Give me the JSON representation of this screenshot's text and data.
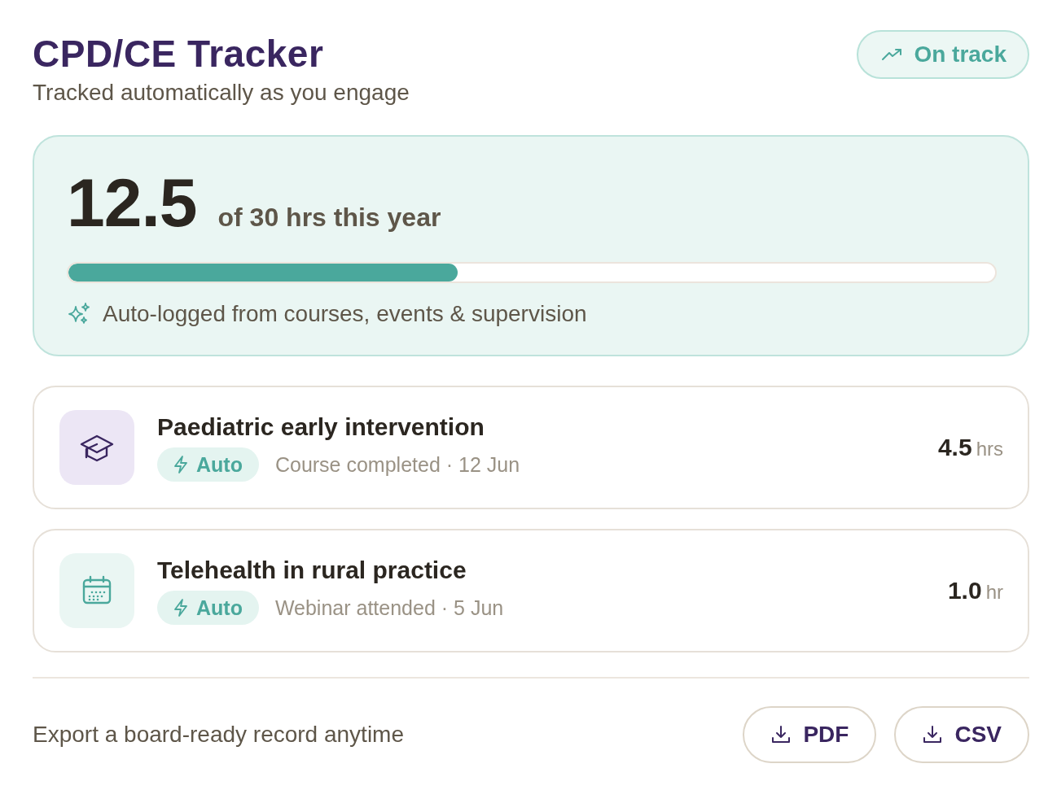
{
  "header": {
    "title": "CPD/CE Tracker",
    "subtitle": "Tracked automatically as you engage",
    "status": {
      "label": "On track",
      "kind": "on-track"
    }
  },
  "summary": {
    "hours": "12.5",
    "target": "of 30 hrs this year",
    "level": 0.42,
    "note": "Auto-logged from courses, events & supervision"
  },
  "activities": [
    {
      "kind": "course",
      "title": "Paediatric early intervention",
      "tag": "Auto",
      "detail": "Course completed · 12 Jun",
      "hours": "4.5",
      "unit": "hrs"
    },
    {
      "kind": "webinar",
      "title": "Telehealth in rural practice",
      "tag": "Auto",
      "detail": "Webinar attended · 5 Jun",
      "hours": "1.0",
      "unit": "hr"
    }
  ],
  "footer": {
    "text": "Export a board-ready record anytime",
    "buttons": [
      "PDF",
      "CSV"
    ]
  }
}
